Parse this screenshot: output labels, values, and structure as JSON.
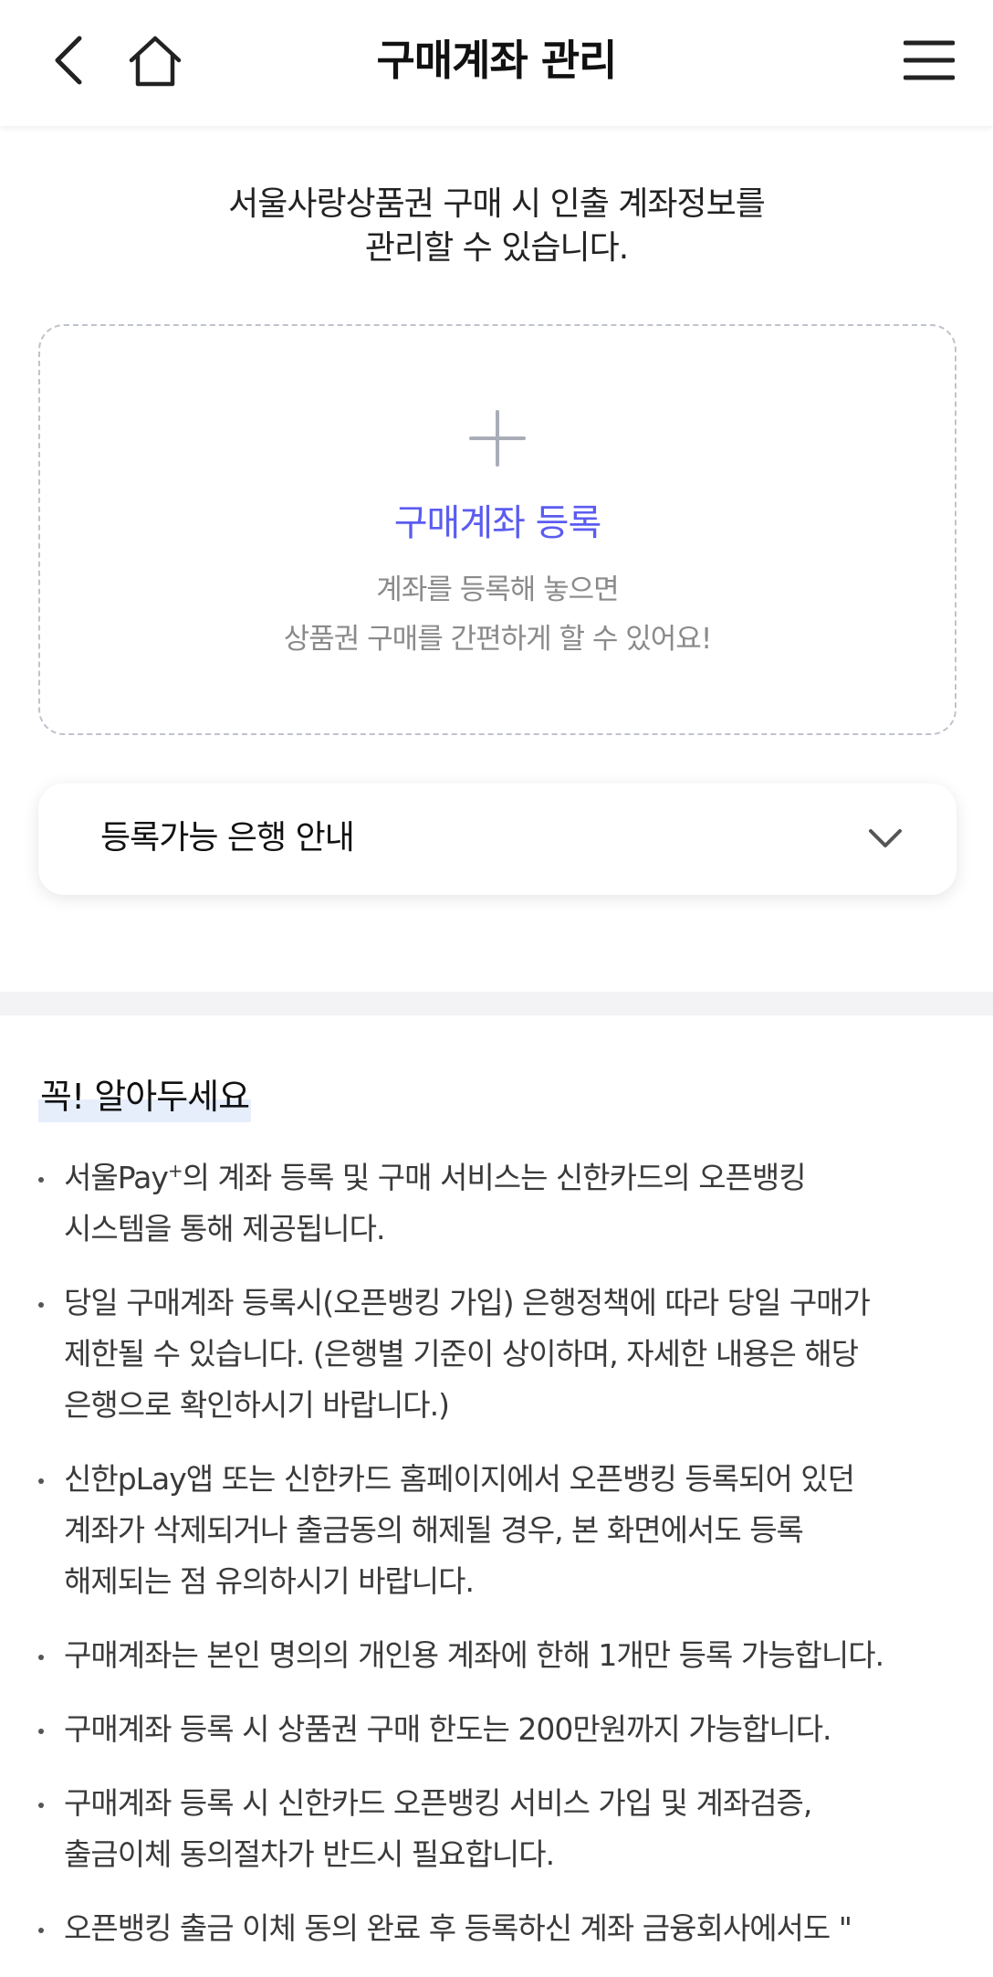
{
  "header": {
    "title": "구매계좌 관리",
    "back_icon": "back-arrow-icon",
    "home_icon": "home-icon",
    "menu_icon": "hamburger-menu-icon"
  },
  "intro": {
    "line1": "서울사랑상품권 구매 시 인출 계좌정보를",
    "line2": "관리할 수 있습니다."
  },
  "register": {
    "title": "구매계좌 등록",
    "desc_line1": "계좌를 등록해 놓으면",
    "desc_line2": "상품권 구매를 간편하게 할 수 있어요!",
    "accent_color": "#5b5cf0"
  },
  "bank_guide": {
    "label": "등록가능 은행 안내"
  },
  "notice": {
    "heading": "꼭! 알아두세요",
    "items": [
      {
        "pre": "서울Pay",
        "sup": "+",
        "post": "의 계좌 등록 및 구매 서비스는 신한카드의 오픈뱅킹",
        "line2": "시스템을 통해 제공됩니다."
      },
      {
        "line1": "당일 구매계좌 등록시(오픈뱅킹 가입) 은행정책에 따라 당일 구매가",
        "line2": "제한될 수 있습니다. (은행별 기준이 상이하며, 자세한 내용은 해당",
        "line3": "은행으로 확인하시기 바랍니다.)"
      },
      {
        "line1": "신한pLay앱 또는 신한카드 홈페이지에서 오픈뱅킹 등록되어 있던",
        "line2": "계좌가 삭제되거나 출금동의 해제될 경우, 본 화면에서도 등록",
        "line3": "해제되는 점 유의하시기 바랍니다."
      },
      {
        "line1": "구매계좌는 본인 명의의 개인용 계좌에 한해 1개만 등록 가능합니다."
      },
      {
        "line1": "구매계좌 등록 시 상품권 구매 한도는 200만원까지 가능합니다."
      },
      {
        "line1": "구매계좌 등록 시 신한카드 오픈뱅킹 서비스 가입 및 계좌검증,",
        "line2": "출금이체 동의절차가 반드시 필요합니다."
      },
      {
        "line1": "오픈뱅킹 출금 이체 동의 완료 후 등록하신 계좌 금융회사에서도 \""
      }
    ]
  }
}
